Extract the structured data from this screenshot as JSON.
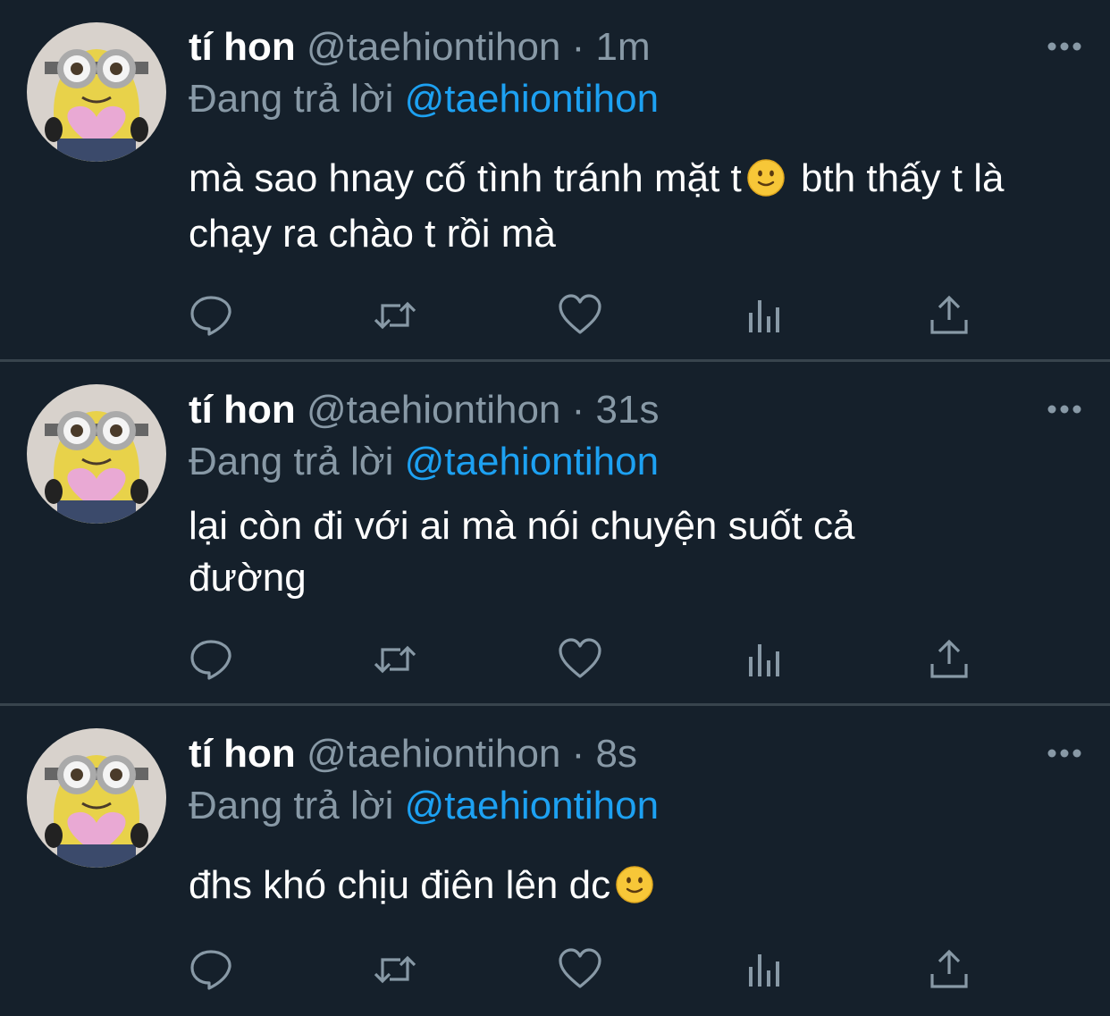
{
  "colors": {
    "background": "#15202b",
    "divider": "#38444d",
    "text_primary": "#ffffff",
    "text_secondary": "#8899a6",
    "link": "#1da1f2"
  },
  "tweets": [
    {
      "display_name": "tí hon",
      "handle": "@taehiontihon",
      "separator": "·",
      "time": "1m",
      "reply_prefix": "Đang trả lời",
      "reply_to": "@taehiontihon",
      "text_before_emoji": "mà sao hnay cố tình tránh mặt t",
      "emoji": "slightly-smiling-face",
      "text_after_emoji": " bth thấy t là chạy ra chào t rồi mà"
    },
    {
      "display_name": "tí hon",
      "handle": "@taehiontihon",
      "separator": "·",
      "time": "31s",
      "reply_prefix": "Đang trả lời",
      "reply_to": "@taehiontihon",
      "text_before_emoji": "lại còn đi với ai mà nói chuyện suốt cả đường",
      "emoji": "",
      "text_after_emoji": ""
    },
    {
      "display_name": "tí hon",
      "handle": "@taehiontihon",
      "separator": "·",
      "time": "8s",
      "reply_prefix": "Đang trả lời",
      "reply_to": "@taehiontihon",
      "text_before_emoji": "đhs khó chịu điên lên dc",
      "emoji": "slightly-smiling-face",
      "text_after_emoji": ""
    }
  ],
  "icons": {
    "avatar": "minion-plush-avatar",
    "more": "more-horizontal-icon",
    "reply": "reply-icon",
    "retweet": "retweet-icon",
    "like": "heart-icon",
    "analytics": "analytics-icon",
    "share": "share-icon",
    "emoji": "slightly-smiling-face-emoji"
  }
}
